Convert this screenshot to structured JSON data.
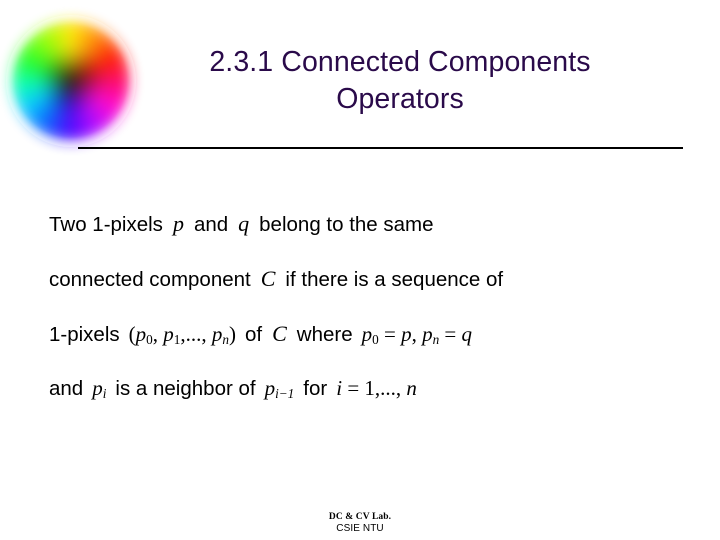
{
  "slide": {
    "background_color": "#ffffff",
    "title_color": "#2a0a4a",
    "body_color": "#000000",
    "rule_color": "#000000"
  },
  "logo": {
    "name": "color-wheel-logo",
    "description": "blurred RGB color wheel"
  },
  "title": {
    "text": "2.3.1 Connected Components\nOperators"
  },
  "body": {
    "line1": {
      "a": "Two 1-pixels",
      "math1": "p",
      "b": "and",
      "math2": "q",
      "c": "belong to the same"
    },
    "line2": {
      "a": "connected component",
      "math1": "C",
      "b": "if there is a sequence of"
    },
    "line3": {
      "a": "1-pixels",
      "math1_open": "(",
      "math1_p0": "p",
      "math1_s0": "0",
      "math1_c1": ", ",
      "math1_p1": "p",
      "math1_s1": "1",
      "math1_dots": ",..., ",
      "math1_pn": "p",
      "math1_sn": "n",
      "math1_close": ")",
      "b": "of",
      "math2": "C",
      "c": "where",
      "math3_p0": "p",
      "math3_s0": "0",
      "math3_eq1": " = ",
      "math3_p": "p",
      "math3_comma": ", ",
      "math3_pn": "p",
      "math3_sn": "n",
      "math3_eq2": " = ",
      "math3_q": "q"
    },
    "line4": {
      "a": "and",
      "math1_p": "p",
      "math1_s": "i",
      "b": "is a neighbor of",
      "math2_p": "p",
      "math2_s": "i−1",
      "c": "for",
      "math3_i": "i",
      "math3_eq": " = ",
      "math3_val": "1,..., ",
      "math3_n": "n"
    }
  },
  "footer": {
    "lab": "DC & CV Lab.",
    "org": "CSIE NTU"
  }
}
